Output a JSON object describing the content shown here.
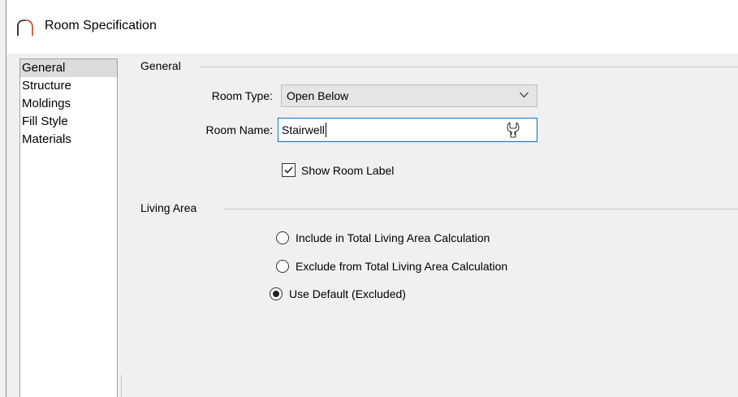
{
  "window": {
    "title": "Room Specification"
  },
  "categories": [
    {
      "label": "General",
      "selected": true
    },
    {
      "label": "Structure",
      "selected": false
    },
    {
      "label": "Moldings",
      "selected": false
    },
    {
      "label": "Fill Style",
      "selected": false
    },
    {
      "label": "Materials",
      "selected": false
    }
  ],
  "general": {
    "group_title": "General",
    "room_type_label": "Room Type:",
    "room_type_value": "Open Below",
    "room_name_label": "Room Name:",
    "room_name_value": "Stairwell",
    "show_label_text": "Show Room Label",
    "show_label_checked": true
  },
  "living_area": {
    "group_title": "Living Area",
    "options": [
      {
        "label": "Include in Total Living Area Calculation",
        "checked": false
      },
      {
        "label": "Exclude from Total Living Area Calculation",
        "checked": false
      },
      {
        "label": "Use Default (Excluded)",
        "checked": true
      }
    ]
  },
  "icons": {
    "app": "arch-icon",
    "dropdown": "chevron-down-icon",
    "room_name_tool": "wrench-icon",
    "checkbox": "checkmark-icon"
  },
  "colors": {
    "accent_border": "#0078d7",
    "selection_bg": "#dcdcdc",
    "dialog_bg": "#f0f0f0"
  }
}
